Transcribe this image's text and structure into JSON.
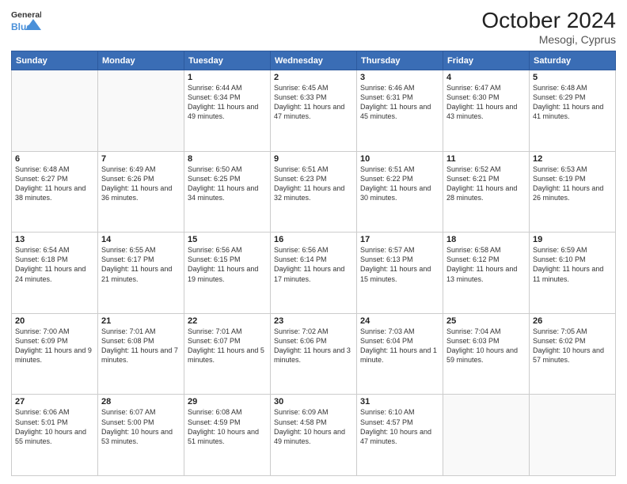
{
  "header": {
    "logo_line1": "General",
    "logo_line2": "Blue",
    "month": "October 2024",
    "location": "Mesogi, Cyprus"
  },
  "weekdays": [
    "Sunday",
    "Monday",
    "Tuesday",
    "Wednesday",
    "Thursday",
    "Friday",
    "Saturday"
  ],
  "weeks": [
    [
      {
        "day": "",
        "text": ""
      },
      {
        "day": "",
        "text": ""
      },
      {
        "day": "1",
        "text": "Sunrise: 6:44 AM\nSunset: 6:34 PM\nDaylight: 11 hours and 49 minutes."
      },
      {
        "day": "2",
        "text": "Sunrise: 6:45 AM\nSunset: 6:33 PM\nDaylight: 11 hours and 47 minutes."
      },
      {
        "day": "3",
        "text": "Sunrise: 6:46 AM\nSunset: 6:31 PM\nDaylight: 11 hours and 45 minutes."
      },
      {
        "day": "4",
        "text": "Sunrise: 6:47 AM\nSunset: 6:30 PM\nDaylight: 11 hours and 43 minutes."
      },
      {
        "day": "5",
        "text": "Sunrise: 6:48 AM\nSunset: 6:29 PM\nDaylight: 11 hours and 41 minutes."
      }
    ],
    [
      {
        "day": "6",
        "text": "Sunrise: 6:48 AM\nSunset: 6:27 PM\nDaylight: 11 hours and 38 minutes."
      },
      {
        "day": "7",
        "text": "Sunrise: 6:49 AM\nSunset: 6:26 PM\nDaylight: 11 hours and 36 minutes."
      },
      {
        "day": "8",
        "text": "Sunrise: 6:50 AM\nSunset: 6:25 PM\nDaylight: 11 hours and 34 minutes."
      },
      {
        "day": "9",
        "text": "Sunrise: 6:51 AM\nSunset: 6:23 PM\nDaylight: 11 hours and 32 minutes."
      },
      {
        "day": "10",
        "text": "Sunrise: 6:51 AM\nSunset: 6:22 PM\nDaylight: 11 hours and 30 minutes."
      },
      {
        "day": "11",
        "text": "Sunrise: 6:52 AM\nSunset: 6:21 PM\nDaylight: 11 hours and 28 minutes."
      },
      {
        "day": "12",
        "text": "Sunrise: 6:53 AM\nSunset: 6:19 PM\nDaylight: 11 hours and 26 minutes."
      }
    ],
    [
      {
        "day": "13",
        "text": "Sunrise: 6:54 AM\nSunset: 6:18 PM\nDaylight: 11 hours and 24 minutes."
      },
      {
        "day": "14",
        "text": "Sunrise: 6:55 AM\nSunset: 6:17 PM\nDaylight: 11 hours and 21 minutes."
      },
      {
        "day": "15",
        "text": "Sunrise: 6:56 AM\nSunset: 6:15 PM\nDaylight: 11 hours and 19 minutes."
      },
      {
        "day": "16",
        "text": "Sunrise: 6:56 AM\nSunset: 6:14 PM\nDaylight: 11 hours and 17 minutes."
      },
      {
        "day": "17",
        "text": "Sunrise: 6:57 AM\nSunset: 6:13 PM\nDaylight: 11 hours and 15 minutes."
      },
      {
        "day": "18",
        "text": "Sunrise: 6:58 AM\nSunset: 6:12 PM\nDaylight: 11 hours and 13 minutes."
      },
      {
        "day": "19",
        "text": "Sunrise: 6:59 AM\nSunset: 6:10 PM\nDaylight: 11 hours and 11 minutes."
      }
    ],
    [
      {
        "day": "20",
        "text": "Sunrise: 7:00 AM\nSunset: 6:09 PM\nDaylight: 11 hours and 9 minutes."
      },
      {
        "day": "21",
        "text": "Sunrise: 7:01 AM\nSunset: 6:08 PM\nDaylight: 11 hours and 7 minutes."
      },
      {
        "day": "22",
        "text": "Sunrise: 7:01 AM\nSunset: 6:07 PM\nDaylight: 11 hours and 5 minutes."
      },
      {
        "day": "23",
        "text": "Sunrise: 7:02 AM\nSunset: 6:06 PM\nDaylight: 11 hours and 3 minutes."
      },
      {
        "day": "24",
        "text": "Sunrise: 7:03 AM\nSunset: 6:04 PM\nDaylight: 11 hours and 1 minute."
      },
      {
        "day": "25",
        "text": "Sunrise: 7:04 AM\nSunset: 6:03 PM\nDaylight: 10 hours and 59 minutes."
      },
      {
        "day": "26",
        "text": "Sunrise: 7:05 AM\nSunset: 6:02 PM\nDaylight: 10 hours and 57 minutes."
      }
    ],
    [
      {
        "day": "27",
        "text": "Sunrise: 6:06 AM\nSunset: 5:01 PM\nDaylight: 10 hours and 55 minutes."
      },
      {
        "day": "28",
        "text": "Sunrise: 6:07 AM\nSunset: 5:00 PM\nDaylight: 10 hours and 53 minutes."
      },
      {
        "day": "29",
        "text": "Sunrise: 6:08 AM\nSunset: 4:59 PM\nDaylight: 10 hours and 51 minutes."
      },
      {
        "day": "30",
        "text": "Sunrise: 6:09 AM\nSunset: 4:58 PM\nDaylight: 10 hours and 49 minutes."
      },
      {
        "day": "31",
        "text": "Sunrise: 6:10 AM\nSunset: 4:57 PM\nDaylight: 10 hours and 47 minutes."
      },
      {
        "day": "",
        "text": ""
      },
      {
        "day": "",
        "text": ""
      }
    ]
  ]
}
